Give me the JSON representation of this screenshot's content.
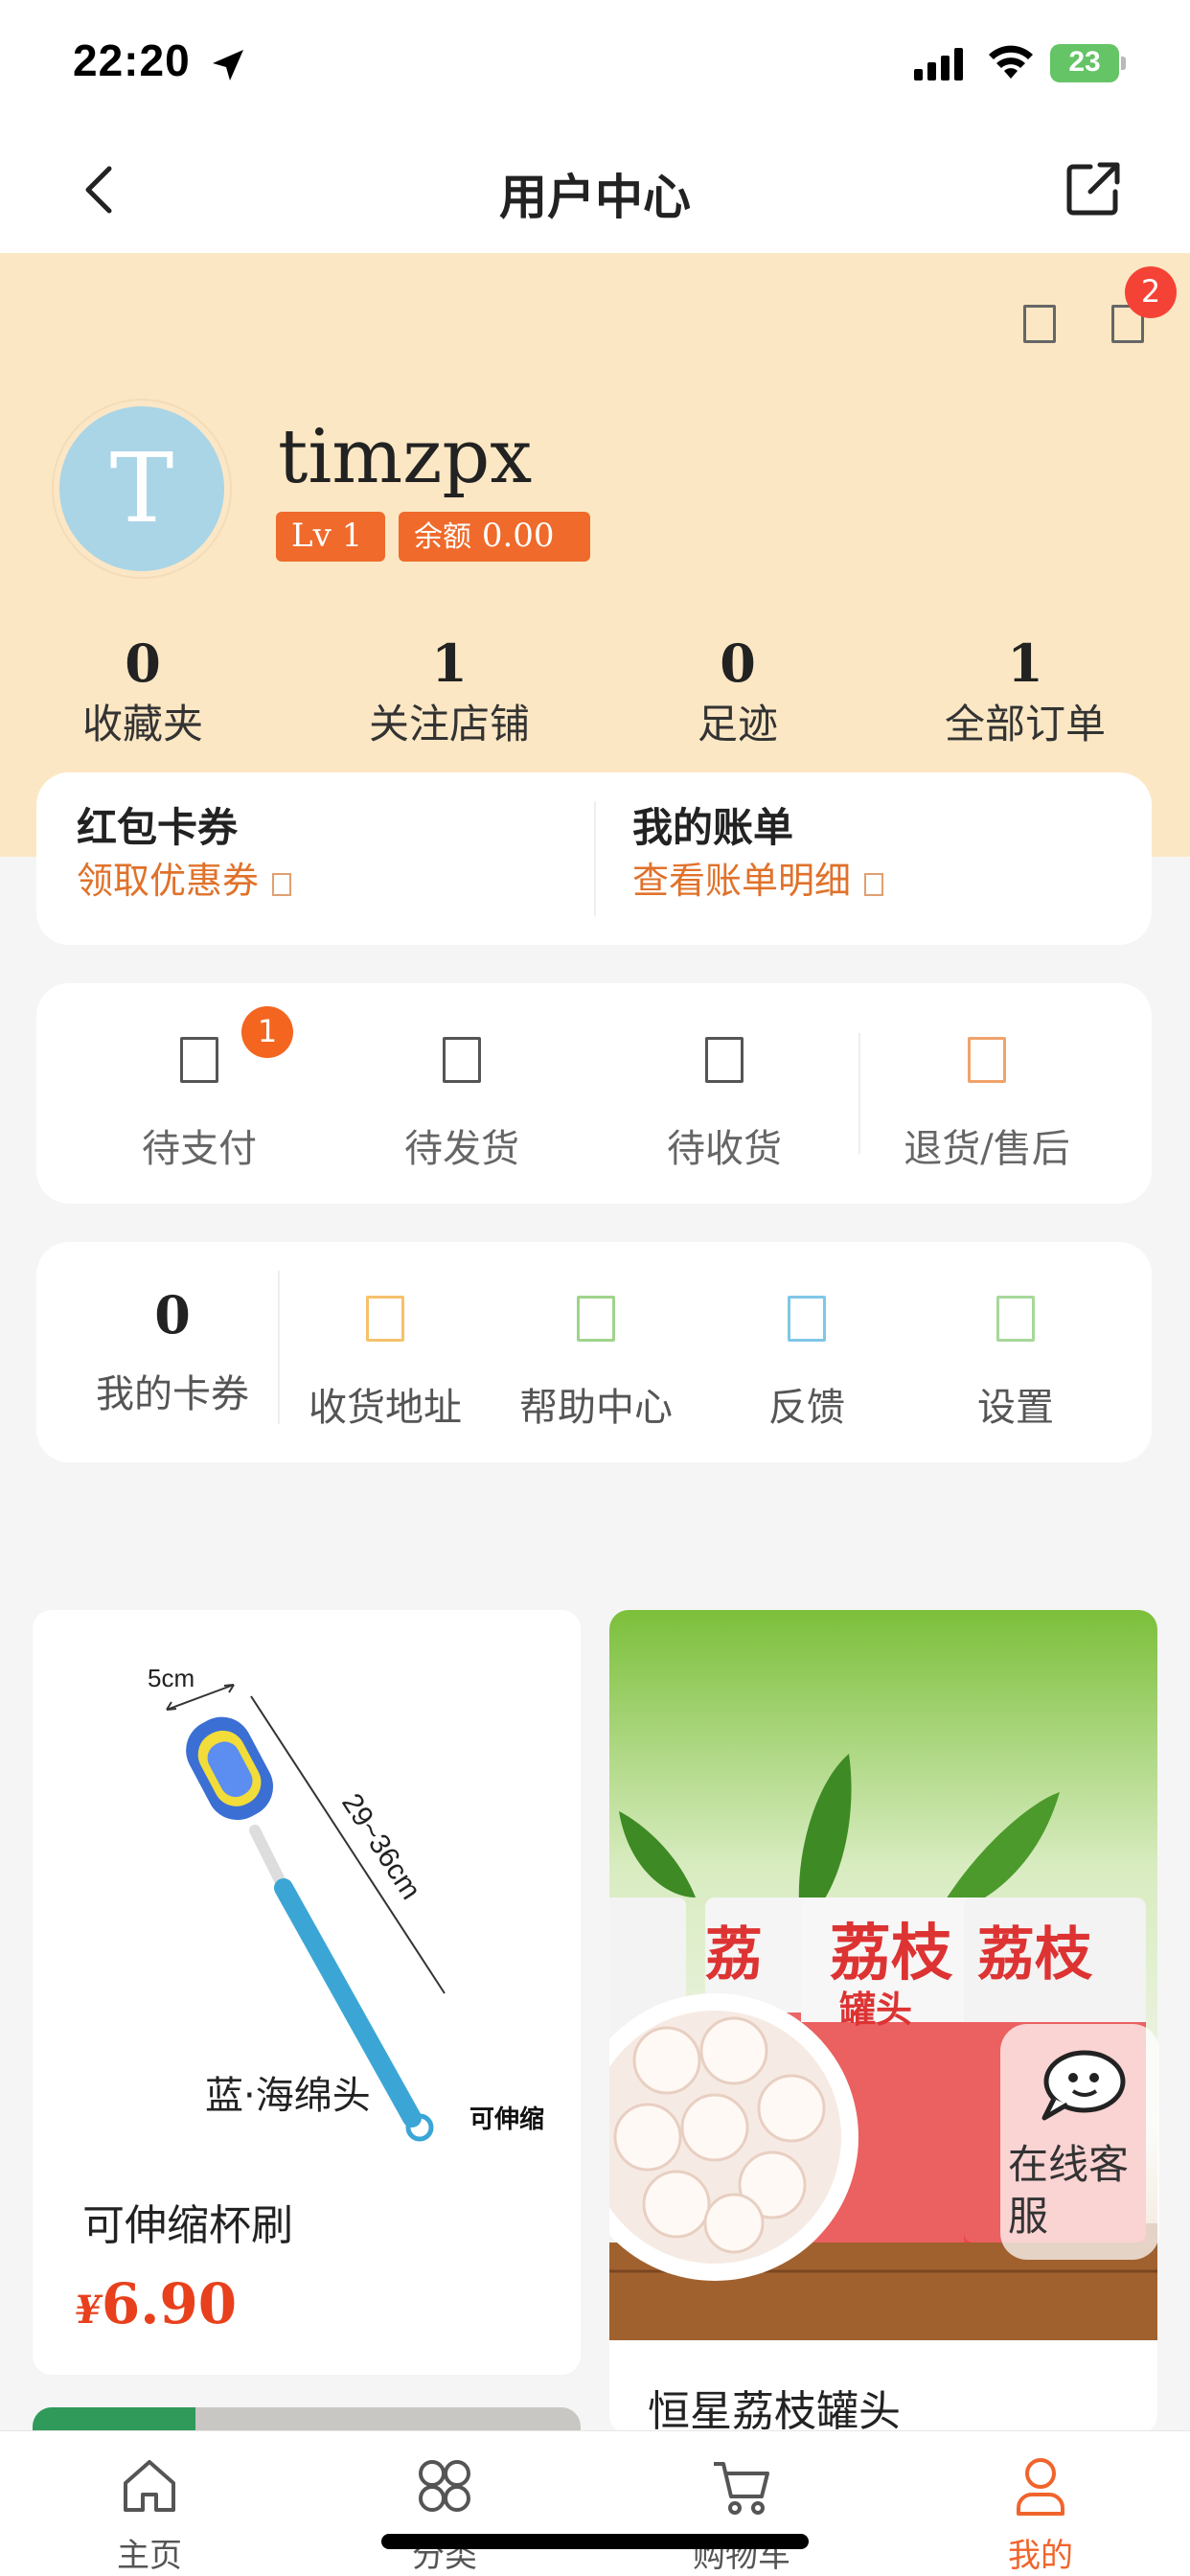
{
  "status_bar": {
    "time": "22:20",
    "battery": "23"
  },
  "nav": {
    "title": "用户中心"
  },
  "header": {
    "message_badge": "2"
  },
  "user": {
    "avatar_letter": "T",
    "name": "timzpx",
    "level": "Lv 1",
    "balance_label": "余额",
    "balance_value": "0.00"
  },
  "stats": [
    {
      "value": "0",
      "label": "收藏夹"
    },
    {
      "value": "1",
      "label": "关注店铺"
    },
    {
      "value": "0",
      "label": "足迹"
    },
    {
      "value": "1",
      "label": "全部订单"
    }
  ],
  "coupon_card": {
    "left_title": "红包卡券",
    "left_sub": "领取优惠券",
    "right_title": "我的账单",
    "right_sub": "查看账单明细"
  },
  "orders": {
    "items": [
      {
        "label": "待支付"
      },
      {
        "label": "待发货"
      },
      {
        "label": "待收货"
      },
      {
        "label": "退货/售后"
      }
    ],
    "pending_badge": "1"
  },
  "tools": {
    "coupon_count": "0",
    "coupon_label": "我的卡券",
    "items": [
      {
        "label": "收货地址",
        "color": "#f5c16c"
      },
      {
        "label": "帮助中心",
        "color": "#9fd48c"
      },
      {
        "label": "反馈",
        "color": "#7fc7e8"
      },
      {
        "label": "设置",
        "color": "#a6d89a"
      }
    ]
  },
  "products": [
    {
      "name": "可伸缩杯刷",
      "currency": "¥",
      "price": "6.90",
      "image_text": [
        "5cm",
        "29~36cm",
        "蓝·海绵头",
        "可伸缩"
      ]
    },
    {
      "name": "恒星荔枝罐头",
      "image_text": [
        "荔枝",
        "罐头",
        "荔",
        "荔枝"
      ]
    }
  ],
  "float_service": {
    "label": "在线客服"
  },
  "tabbar": [
    {
      "label": "主页",
      "icon": "home-icon"
    },
    {
      "label": "分类",
      "icon": "grid-icon"
    },
    {
      "label": "购物车",
      "icon": "cart-icon"
    },
    {
      "label": "我的",
      "icon": "user-icon",
      "active": true
    }
  ],
  "colors": {
    "accent": "#f0642b",
    "header_bg": "#fce7c4",
    "price": "#e8401c"
  }
}
